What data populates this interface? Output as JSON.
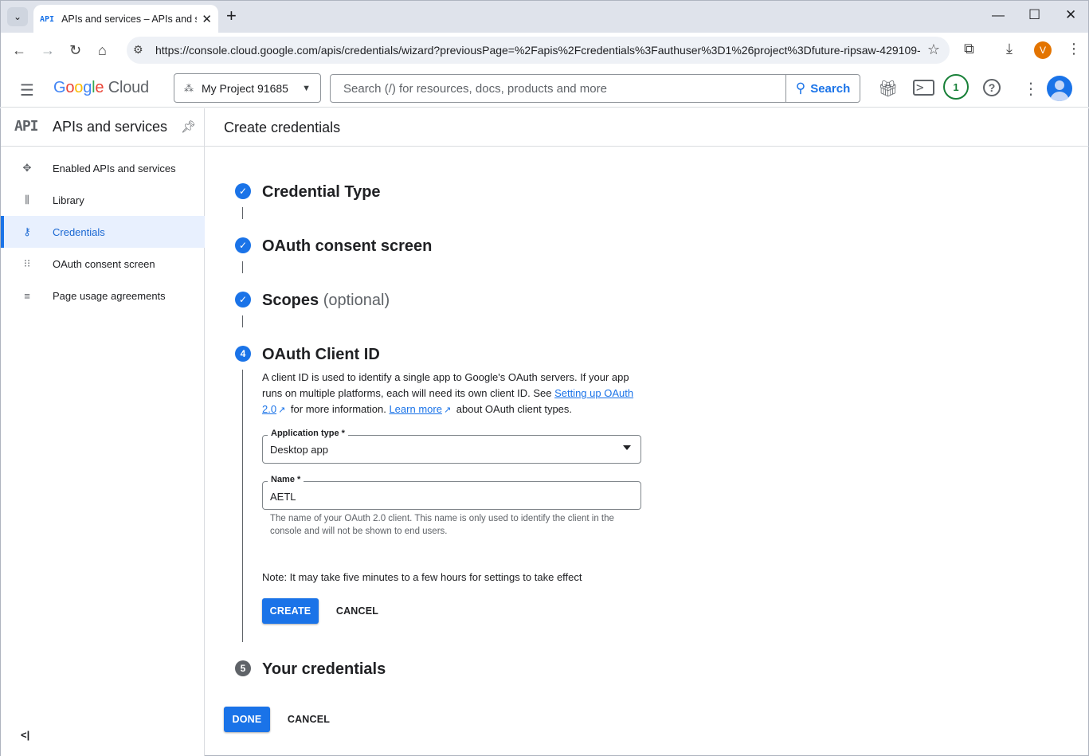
{
  "browser": {
    "tab_favicon": "API",
    "tab_title": "APIs and services – APIs and services",
    "url": "https://console.cloud.google.com/apis/credentials/wizard?previousPage=%2Fapis%2Fcredentials%3Fauthuser%3D1%26project%3Dfuture-ripsaw-429109-...",
    "profile_initial": "V"
  },
  "header": {
    "logo": {
      "g": "G",
      "o1": "o",
      "o2": "o",
      "g2": "g",
      "l": "l",
      "e": "e",
      "cloud": "Cloud"
    },
    "project": "My Project 91685",
    "search_placeholder": "Search (/) for resources, docs, products and more",
    "search_button": "Search",
    "notification_count": "1"
  },
  "sidebar": {
    "icon_text": "API",
    "title": "APIs and services",
    "items": [
      {
        "label": "Enabled APIs and services",
        "icon": "move-icon",
        "active": false
      },
      {
        "label": "Library",
        "icon": "library-icon",
        "active": false
      },
      {
        "label": "Credentials",
        "icon": "key-icon",
        "active": true
      },
      {
        "label": "OAuth consent screen",
        "icon": "consent-icon",
        "active": false
      },
      {
        "label": "Page usage agreements",
        "icon": "settings-list-icon",
        "active": false
      }
    ]
  },
  "page": {
    "title": "Create credentials",
    "steps": [
      {
        "number": "1",
        "title": "Credential Type",
        "optional": "",
        "state": "done"
      },
      {
        "number": "2",
        "title": "OAuth consent screen",
        "optional": "",
        "state": "done"
      },
      {
        "number": "3",
        "title": "Scopes",
        "optional": "(optional)",
        "state": "done"
      },
      {
        "number": "4",
        "title": "OAuth Client ID",
        "optional": "",
        "state": "active"
      },
      {
        "number": "5",
        "title": "Your credentials",
        "optional": "",
        "state": "pending"
      }
    ],
    "description": {
      "part1": "A client ID is used to identify a single app to Google's OAuth servers. If your app runs on multiple platforms, each will need its own client ID. See ",
      "link1": "Setting up OAuth 2.0",
      "part2": " for more information. ",
      "link2": "Learn more",
      "part3": " about OAuth client types."
    },
    "app_type_label": "Application type *",
    "app_type_value": "Desktop app",
    "name_label": "Name *",
    "name_value": "AETL",
    "name_hint": "The name of your OAuth 2.0 client. This name is only used to identify the client in the console and will not be shown to end users.",
    "note": "Note: It may take five minutes to a few hours for settings to take effect",
    "create_button": "CREATE",
    "cancel_button": "CANCEL",
    "done_button": "DONE",
    "cancel_button_bottom": "CANCEL"
  },
  "colors": {
    "accent": "#1a73e8",
    "active_bg": "#e8f0fe",
    "notification": "#188038"
  }
}
